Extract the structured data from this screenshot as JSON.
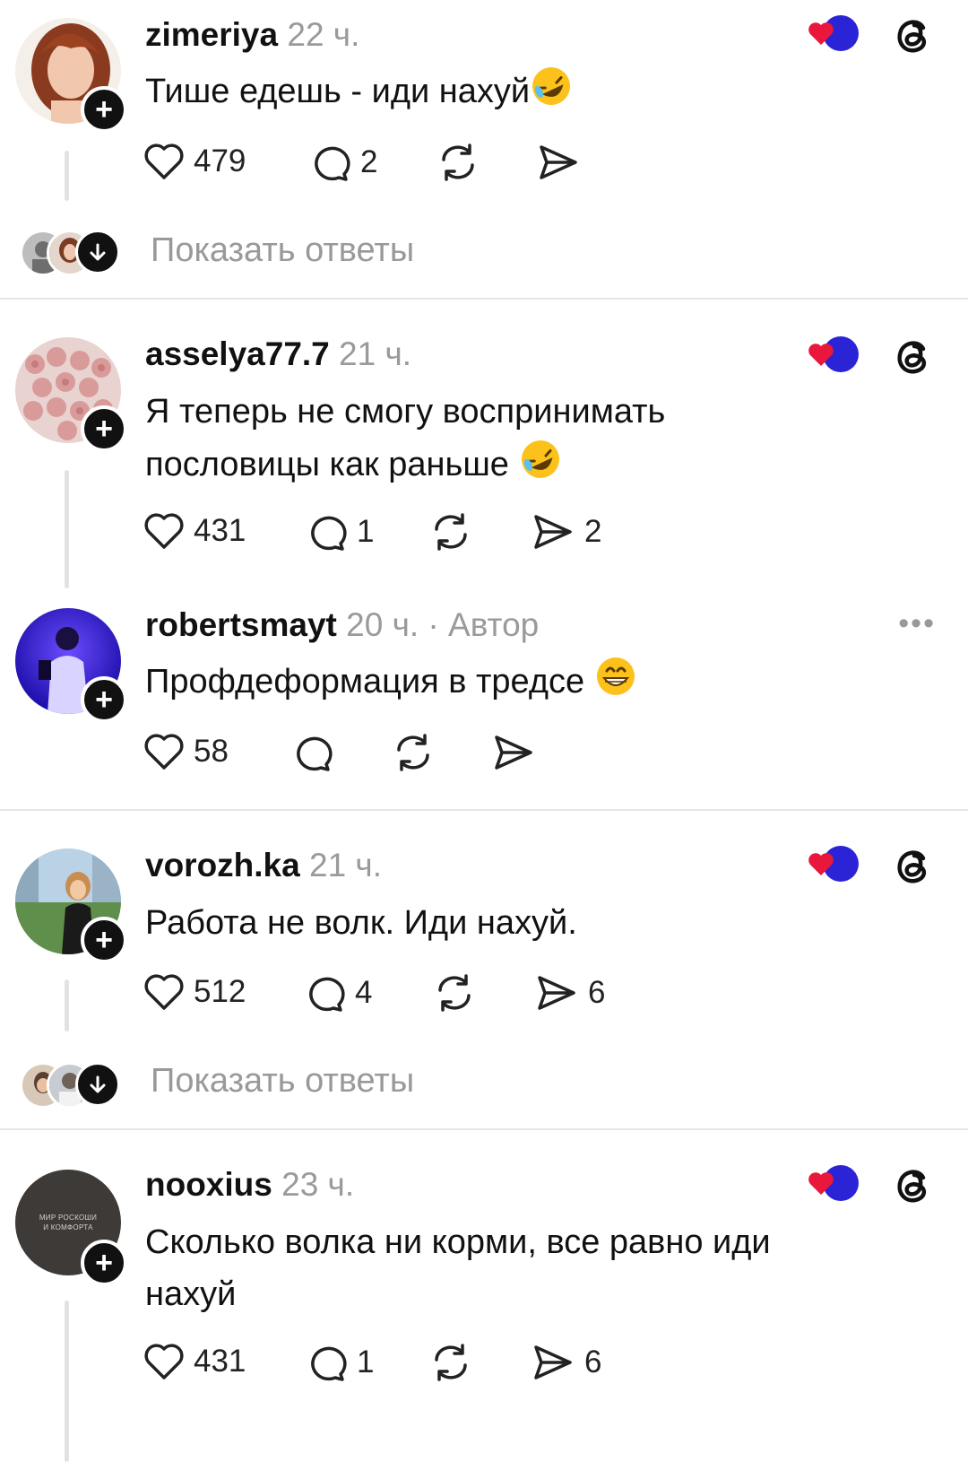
{
  "posts": [
    {
      "username": "zimeriya",
      "time": "22 ч.",
      "text": "Тише едешь - иди нахуй",
      "emoji": "rofl",
      "likes": "479",
      "comments": "2",
      "shares": "",
      "show_replies": "Показать ответы",
      "avatar_icon": "woman-portrait-avatar",
      "avatar_color": "#c87a55"
    },
    {
      "username": "asselya77.7",
      "time": "21 ч.",
      "text": "Я теперь не смогу воспринимать пословицы как раньше",
      "emoji": "rofl",
      "likes": "431",
      "comments": "1",
      "shares": "2",
      "avatar_icon": "roses-avatar",
      "avatar_color": "#d9a7a7"
    },
    {
      "username": "robertsmayt",
      "time": "20 ч.",
      "author_label": "· Автор",
      "text": "Профдеформация в тредсе",
      "emoji": "grin",
      "likes": "58",
      "comments": "",
      "shares": "",
      "avatar_icon": "man-purple-light-avatar",
      "avatar_color": "#3a1ad8"
    },
    {
      "username": "vorozh.ka",
      "time": "21 ч.",
      "text": "Работа не волк. Иди нахуй.",
      "likes": "512",
      "comments": "4",
      "shares": "6",
      "show_replies": "Показать ответы",
      "avatar_icon": "woman-city-avatar",
      "avatar_color": "#6f9a5a"
    },
    {
      "username": "nooxius",
      "time": "23 ч.",
      "text": "Сколько волка ни корми, все равно иди нахуй",
      "likes": "431",
      "comments": "1",
      "shares": "6",
      "avatar_text_1": "МИР РОСКОШИ",
      "avatar_text_2": "И КОМФОРТА",
      "avatar_icon": "luxury-logo-avatar",
      "avatar_color": "#3d3a37"
    }
  ],
  "colors": {
    "heart_red": "#e8173b",
    "reaction_blue": "#2a24d6",
    "meta_gray": "#9a9a9a"
  }
}
